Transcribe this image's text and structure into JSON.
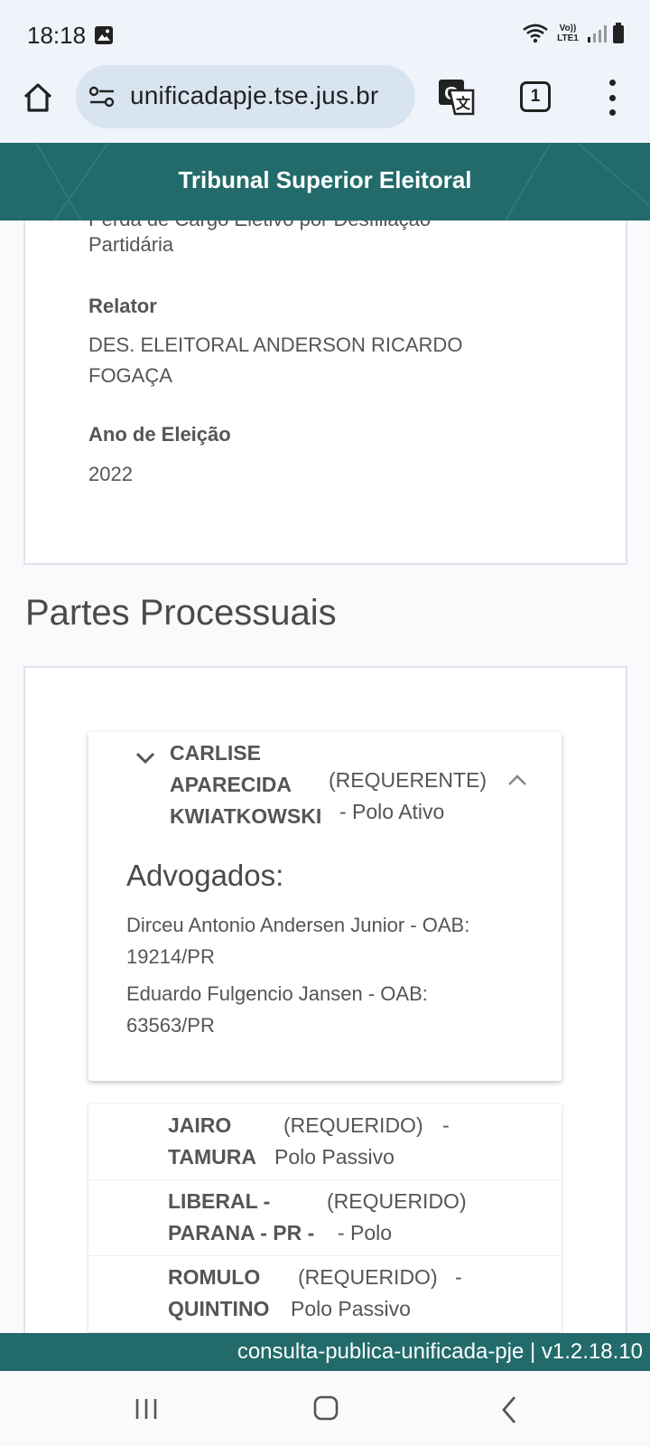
{
  "status_bar": {
    "time": "18:18",
    "network_label": "Vo)) LTE1",
    "icons": [
      "gallery-icon",
      "wifi-icon",
      "signal-icon",
      "battery-icon"
    ]
  },
  "browser": {
    "url": "unificadapje.tse.jus.br",
    "tab_count": "1",
    "icons": [
      "home-icon",
      "site-settings-icon",
      "translate-icon",
      "menu-dots-icon"
    ]
  },
  "header": {
    "title": "Tribunal Superior Eleitoral",
    "background_color": "#236b6b"
  },
  "process_info": {
    "cut_off_text": "Perda de Cargo Eletivo por Desfiliação",
    "class_continuation": "Partidária",
    "relator_label": "Relator",
    "relator_line1": "DES. ELEITORAL ANDERSON RICARDO",
    "relator_line2": "FOGAÇA",
    "election_year_label": "Ano de Eleição",
    "election_year": "2022"
  },
  "parties": {
    "section_title": "Partes Processuais",
    "expanded": {
      "name_line1": "CARLISE",
      "name_line2": "APARECIDA",
      "name_line3": "KWIATKOWSKI",
      "role": "(REQUERENTE)",
      "polo": "- Polo Ativo",
      "lawyers_title": "Advogados:",
      "lawyers": [
        {
          "line1": "Dirceu Antonio Andersen Junior - OAB:",
          "line2": "19214/PR"
        },
        {
          "line1": "Eduardo Fulgencio Jansen - OAB:",
          "line2": "63563/PR"
        }
      ]
    },
    "list": [
      {
        "name_line1": "JAIRO",
        "name_line2": "TAMURA",
        "role": "(REQUERIDO)",
        "role_dash": "-",
        "polo": "Polo Passivo"
      },
      {
        "name_line1": "LIBERAL -",
        "name_line2": "PARANA - PR -",
        "role": "(REQUERIDO)",
        "role_dash": "",
        "polo": "- Polo"
      },
      {
        "name_line1": "ROMULO",
        "name_line2": "QUINTINO",
        "role": "(REQUERIDO)",
        "role_dash": "-",
        "polo": "Polo Passivo"
      }
    ]
  },
  "footer": {
    "version": "consulta-publica-unificada-pje | v1.2.18.10"
  },
  "nav": {
    "icons": [
      "recent-apps-icon",
      "home-nav-icon",
      "back-icon"
    ]
  }
}
